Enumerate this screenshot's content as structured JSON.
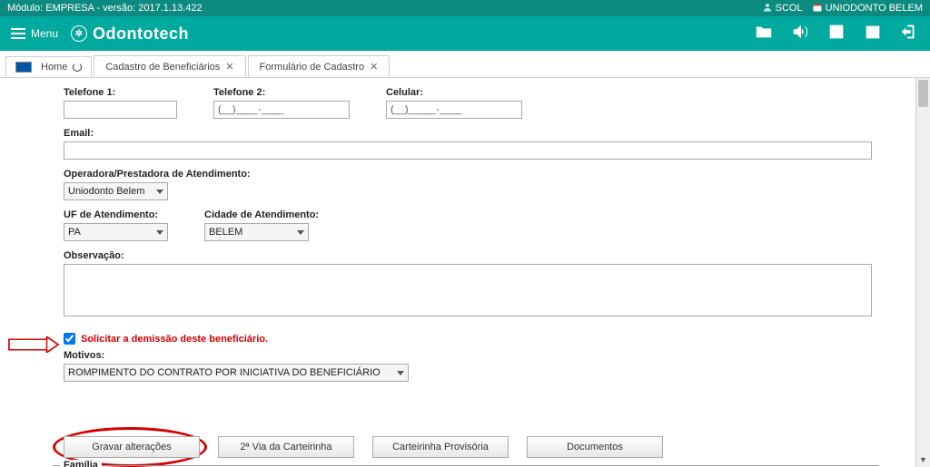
{
  "topbar": {
    "module_text": "Módulo: EMPRESA - versão: 2017.1.13.422",
    "user1": "SCOL",
    "user2": "UNIODONTO BELEM"
  },
  "header": {
    "menu_label": "Menu",
    "logo_text": "Odontotech"
  },
  "tabs": {
    "home": "Home",
    "t1": "Cadastro de Beneficiários",
    "t2": "Formulário de Cadastro"
  },
  "form": {
    "tel1_label": "Telefone 1:",
    "tel1_value": "",
    "tel2_label": "Telefone 2:",
    "tel2_value": "(__)____-____",
    "cel_label": "Celular:",
    "cel_value": "(__)_____-____",
    "email_label": "Email:",
    "email_value": "",
    "operadora_label": "Operadora/Prestadora de Atendimento:",
    "operadora_value": "Uniodonto Belem",
    "uf_label": "UF de Atendimento:",
    "uf_value": "PA",
    "cidade_label": "Cidade de Atendimento:",
    "cidade_value": "BELEM",
    "obs_label": "Observação:",
    "chk_label": "Solicitar a demissão deste beneficiário.",
    "motivos_label": "Motivos:",
    "motivos_value": "ROMPIMENTO DO CONTRATO POR INICIATIVA DO BENEFICIÁRIO",
    "familia_label": "Família"
  },
  "buttons": {
    "gravar": "Gravar alterações",
    "via2": "2ª Via da Carteirinha",
    "prov": "Carteirinha Provisória",
    "docs": "Documentos"
  }
}
